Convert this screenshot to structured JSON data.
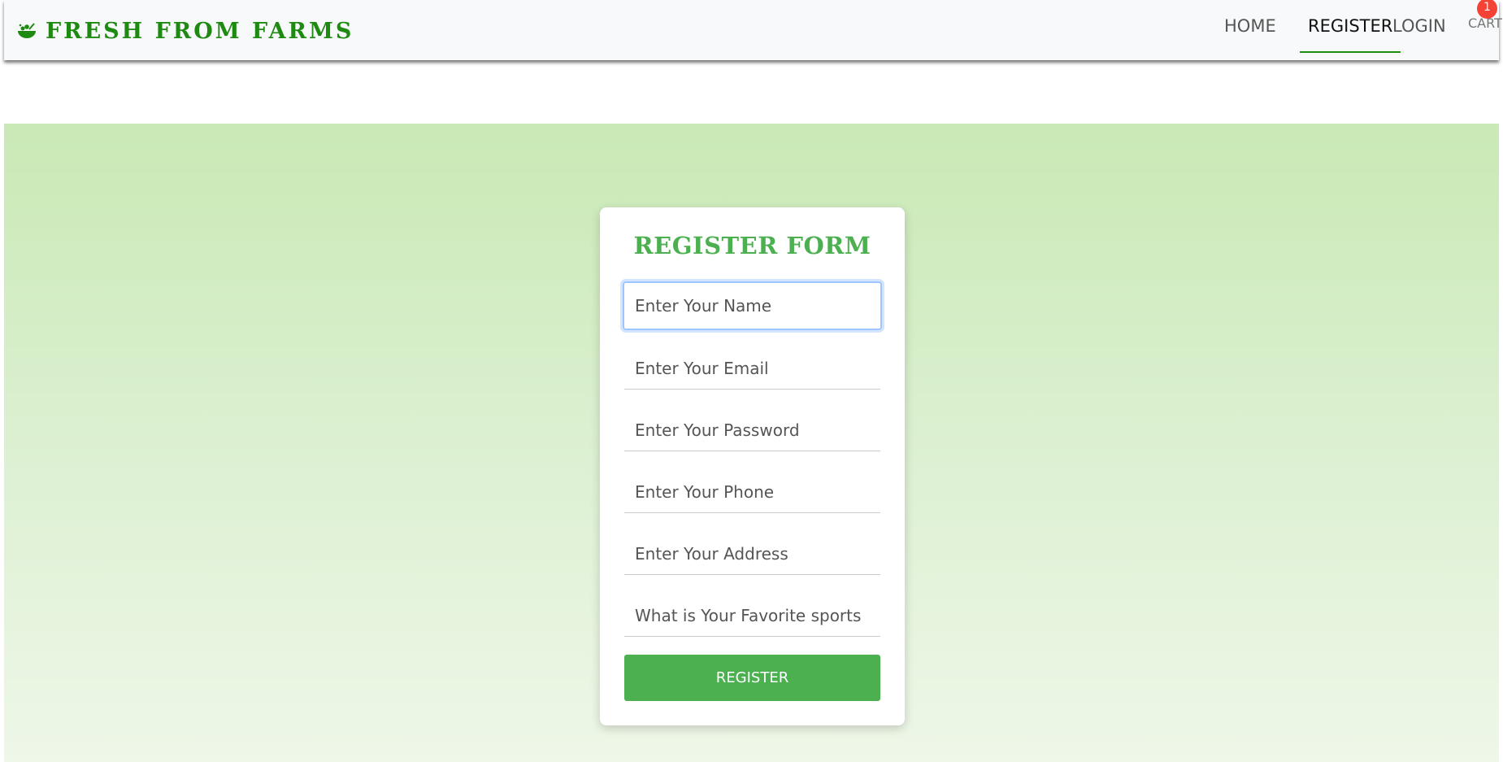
{
  "brand": {
    "name": "FRESH FROM FARMS",
    "icon": "salad-bowl-icon",
    "color": "#1e8a12"
  },
  "nav": {
    "items": [
      {
        "label": "HOME",
        "active": false
      },
      {
        "label": "REGISTER",
        "active": true
      },
      {
        "label": "LOGIN",
        "active": false
      }
    ],
    "cart": {
      "label": "CART",
      "badge": "1"
    }
  },
  "form": {
    "title": "REGISTER FORM",
    "fields": {
      "name": {
        "placeholder": "Enter Your Name",
        "focused": true
      },
      "email": {
        "placeholder": "Enter Your Email"
      },
      "password": {
        "placeholder": "Enter Your Password"
      },
      "phone": {
        "placeholder": "Enter Your Phone"
      },
      "address": {
        "placeholder": "Enter Your Address"
      },
      "sports": {
        "placeholder": "What is Your Favorite sports"
      }
    },
    "submit_label": "REGISTER"
  },
  "colors": {
    "accent": "#4caf50",
    "badge": "#f44336",
    "hero_top": "#c9e9b5",
    "hero_bottom": "#eef7e8"
  }
}
